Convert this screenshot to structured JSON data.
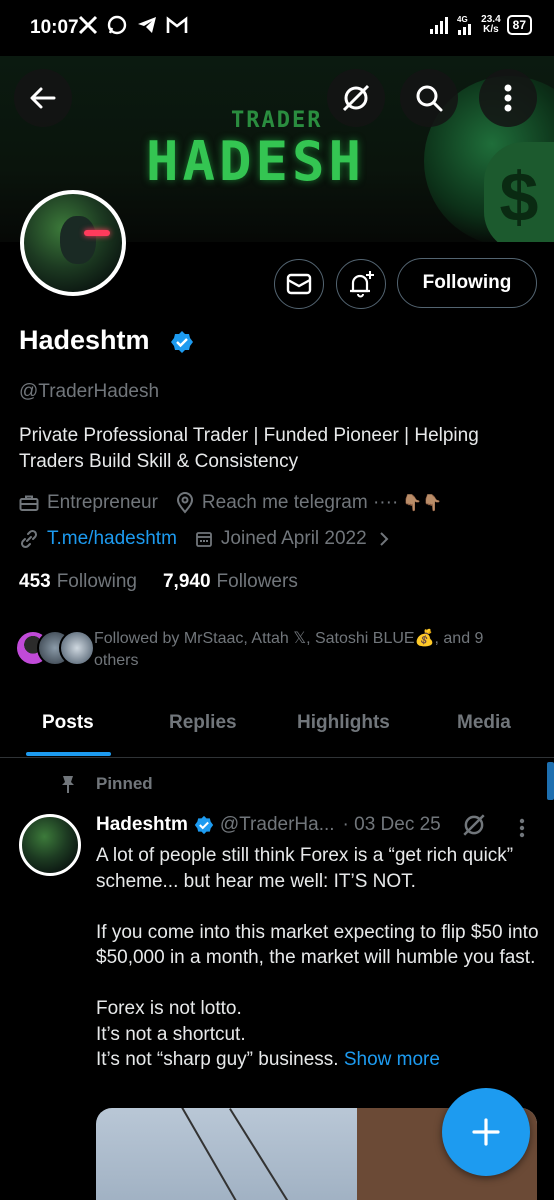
{
  "status_bar": {
    "time": "10:07",
    "net_speed_value": "23.4",
    "net_speed_unit": "K/s",
    "network": "4G",
    "battery": "87"
  },
  "banner": {
    "line1": "TRADER",
    "line2": "HADESH"
  },
  "profile": {
    "name": "Hadeshtm",
    "handle": "@TraderHadesh",
    "bio": "Private Professional Trader | Funded Pioneer | Helping Traders Build Skill & Consistency",
    "category": "Entrepreneur",
    "location": "Reach me telegram ····",
    "location_emoji": "👇🏽👇🏽",
    "link": "T.me/hadeshtm",
    "joined": "Joined April 2022",
    "following_count": "453",
    "following_label": "Following",
    "followers_count": "7,940",
    "followers_label": "Followers",
    "followed_by": "Followed by MrStaac, Attah 𝕏, Satoshi BLUE💰, and 9 others",
    "follow_button": "Following"
  },
  "tabs": [
    "Posts",
    "Replies",
    "Highlights",
    "Media"
  ],
  "active_tab": "Posts",
  "pinned_label": "Pinned",
  "tweet": {
    "name": "Hadeshtm",
    "handle": "@TraderHa...",
    "date": "· 03 Dec 25",
    "para1": "A lot of people still think Forex is a “get rich quick” scheme... but hear me well: IT’S NOT.",
    "para2": "If you come into this market expecting to flip $50 into $50,000 in a month, the market will humble you fast.",
    "line3": "Forex is not lotto.",
    "line4": "It’s not a shortcut.",
    "line5": "It’s not “sharp guy” business.",
    "show_more": "Show more"
  },
  "colors": {
    "accent": "#1d9bf0",
    "banner_green": "#34c552",
    "muted": "#71767b"
  },
  "icons": [
    "back-arrow-icon",
    "grok-icon",
    "search-icon",
    "more-vertical-icon",
    "mail-icon",
    "bell-plus-icon",
    "verified-badge-icon",
    "briefcase-icon",
    "location-icon",
    "link-icon",
    "calendar-icon",
    "chevron-right-icon",
    "pin-icon",
    "compose-plus-icon"
  ]
}
